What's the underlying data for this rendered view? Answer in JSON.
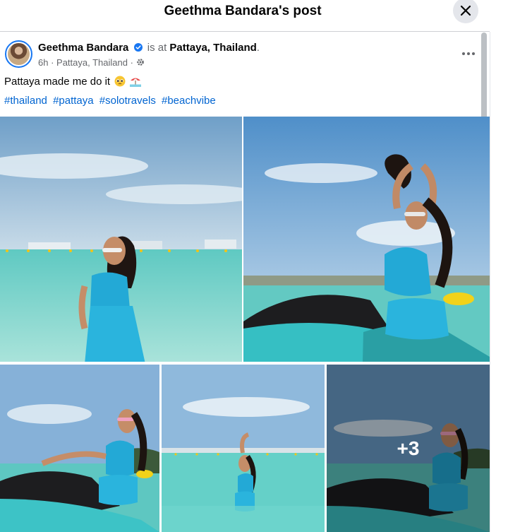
{
  "dialog": {
    "title": "Geethma Bandara's post",
    "close_icon": "close-icon"
  },
  "post": {
    "author": "Geethma Bandara",
    "verified_icon": "verified-badge-icon",
    "is_at": "is at",
    "place": "Pattaya, Thailand",
    "place_suffix": ".",
    "time": "6h",
    "meta_sep": " · ",
    "meta_location": "Pattaya, Thailand",
    "privacy_icon": "gear-icon",
    "more_icon": "more-options-icon",
    "caption": "Pattaya made me do it",
    "caption_emojis": [
      "pleading-face-emoji",
      "beach-umbrella-emoji"
    ],
    "hashtags": [
      "#thailand",
      "#pattaya",
      "#solotravels",
      "#beachvibe"
    ]
  },
  "photos": {
    "more_count": "+3"
  },
  "colors": {
    "accent": "#1877f2",
    "link": "#0064d1",
    "secondary_text": "#65676b",
    "sea": "#56c6c4",
    "sky": "#9cc4df",
    "swimsuit": "#23a9d6"
  }
}
